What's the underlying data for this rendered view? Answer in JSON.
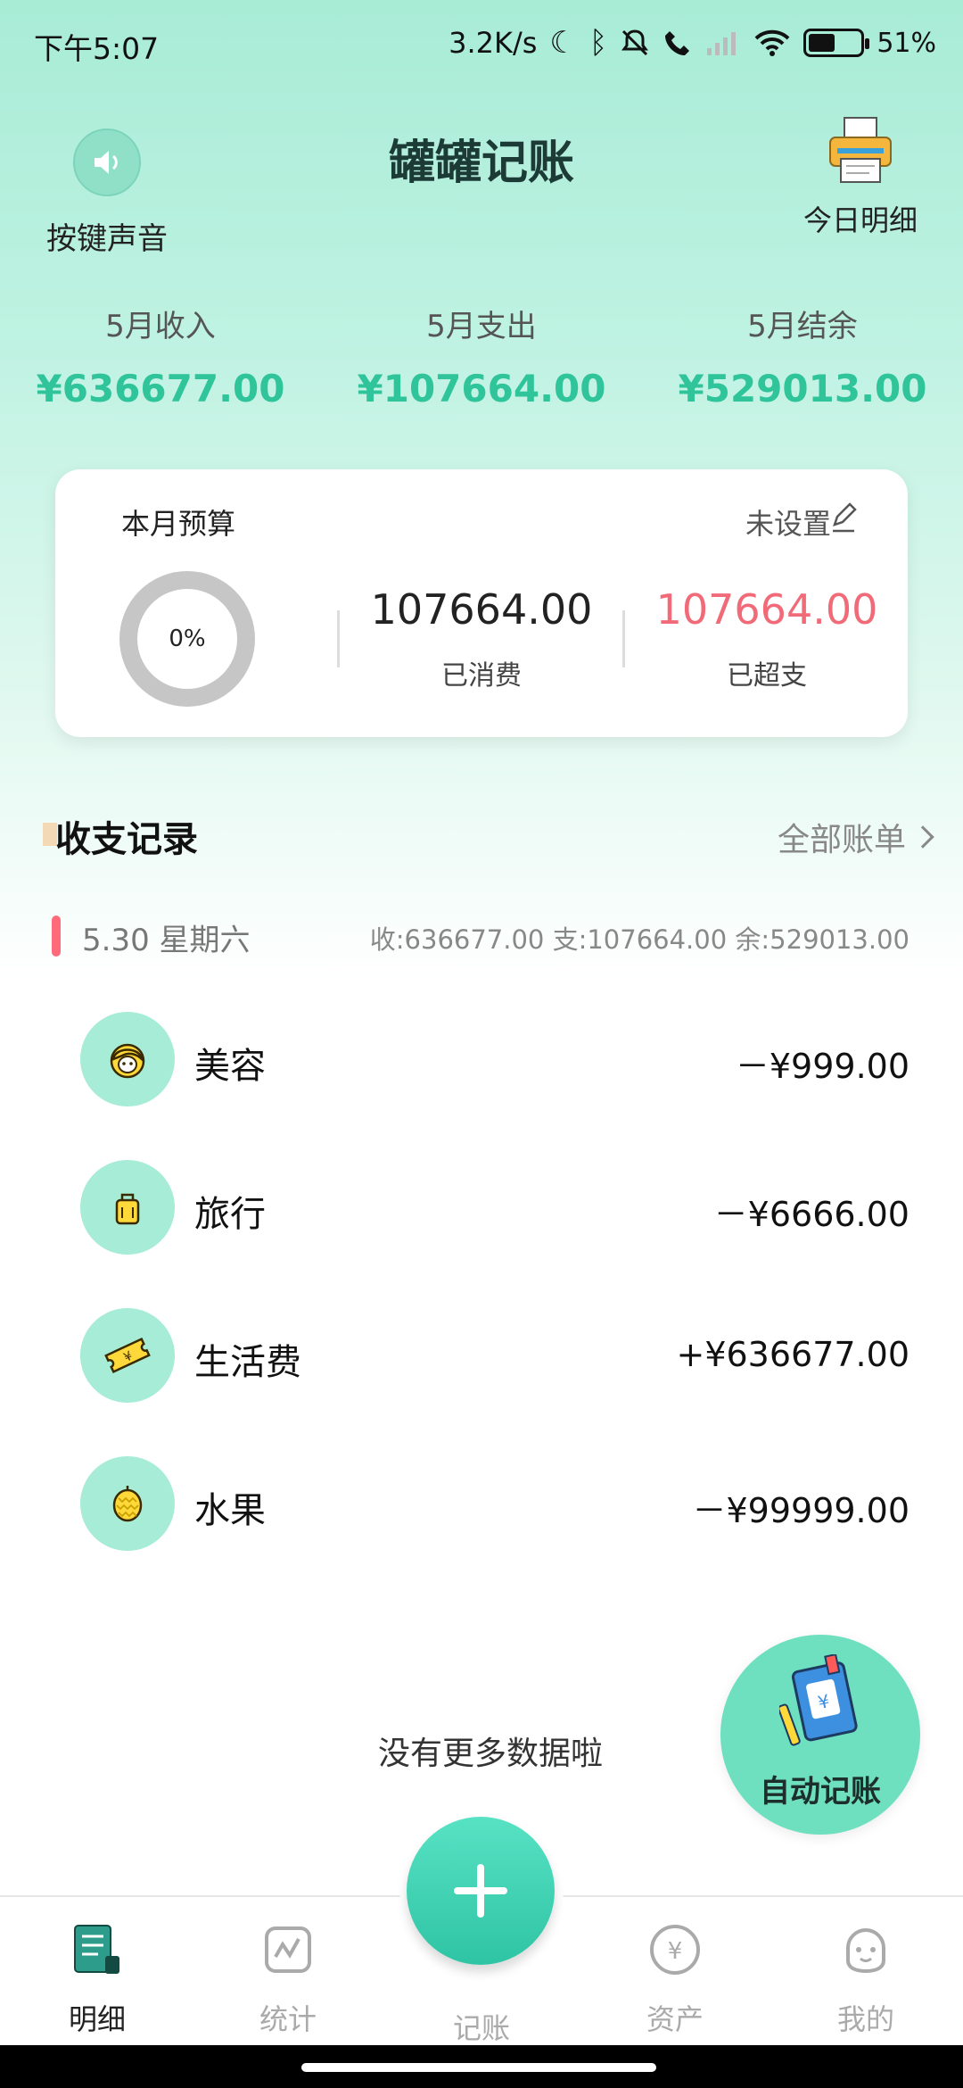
{
  "status_bar": {
    "time": "下午5:07",
    "net_speed": "3.2K/s",
    "battery_pct": "51%",
    "battery_level": 0.51
  },
  "header": {
    "title": "罐罐记账",
    "sound_label": "按键声音",
    "today_label": "今日明细"
  },
  "summary": {
    "income_title": "5月收入",
    "income": "¥636677.00",
    "expense_title": "5月支出",
    "expense": "¥107664.00",
    "balance_title": "5月结余",
    "balance": "¥529013.00"
  },
  "budget": {
    "title": "本月预算",
    "status": "未设置",
    "percent": "0%",
    "spent": "107664.00",
    "spent_label": "已消费",
    "over": "107664.00",
    "over_label": "已超支",
    "over_color": "#f06a78"
  },
  "records": {
    "title": "收支记录",
    "all_bills": "全部账单",
    "day": {
      "date": "5.30 星期六",
      "summary": "收:636677.00 支:107664.00 余:529013.00"
    },
    "items": [
      {
        "name": "美容",
        "amount": "－¥999.00",
        "icon": "beauty-icon"
      },
      {
        "name": "旅行",
        "amount": "－¥6666.00",
        "icon": "luggage-icon"
      },
      {
        "name": "生活费",
        "amount": "+¥636677.00",
        "icon": "ticket-icon"
      },
      {
        "name": "水果",
        "amount": "－¥99999.00",
        "icon": "durian-icon"
      }
    ],
    "no_more": "没有更多数据啦"
  },
  "auto_button": {
    "label": "自动记账"
  },
  "nav": {
    "items": [
      {
        "label": "明细",
        "icon": "list-icon"
      },
      {
        "label": "统计",
        "icon": "chart-icon"
      },
      {
        "label": "记账",
        "icon": "plus-icon"
      },
      {
        "label": "资产",
        "icon": "yuan-icon"
      },
      {
        "label": "我的",
        "icon": "profile-icon"
      }
    ]
  },
  "colors": {
    "accent": "#2fc49a",
    "header_bg": "#a8ecd6",
    "negative": "#f06a78"
  }
}
